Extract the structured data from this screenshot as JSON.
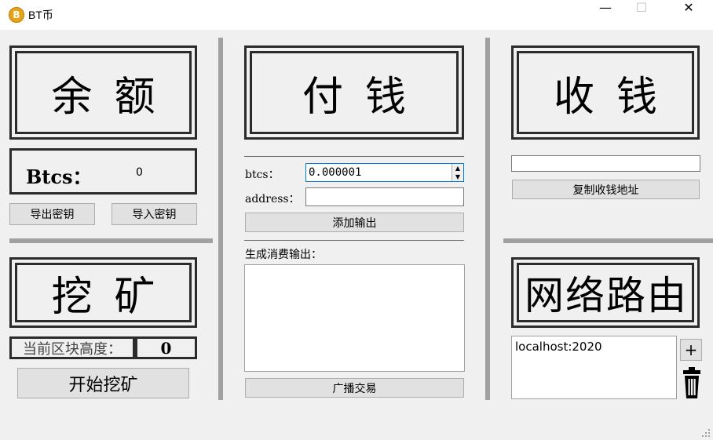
{
  "window": {
    "title": "BT币",
    "icon_glyph": "B",
    "controls": {
      "minimize": "—",
      "maximize": "☐",
      "close": "✕"
    }
  },
  "balance": {
    "heading": "余额",
    "btcs_label": "Btcs：",
    "btcs_value": "0",
    "export_key": "导出密钥",
    "import_key": "导入密钥"
  },
  "mining": {
    "heading": "挖矿",
    "height_label": "当前区块高度：",
    "height_value": "0",
    "start_button": "开始挖矿"
  },
  "pay": {
    "heading": "付钱",
    "btcs_label": "btcs：",
    "btcs_value": "0.000001",
    "address_label": "address：",
    "address_value": "",
    "add_output": "添加输出",
    "outputs_label": "生成消费输出：",
    "outputs_text": "",
    "broadcast": "广播交易"
  },
  "receive": {
    "heading": "收钱",
    "address_value": "",
    "copy_address": "复制收钱地址"
  },
  "network": {
    "heading": "网络路由",
    "routes": [
      "localhost:2020"
    ],
    "add_glyph": "+",
    "delete_icon": "trash-icon"
  }
}
